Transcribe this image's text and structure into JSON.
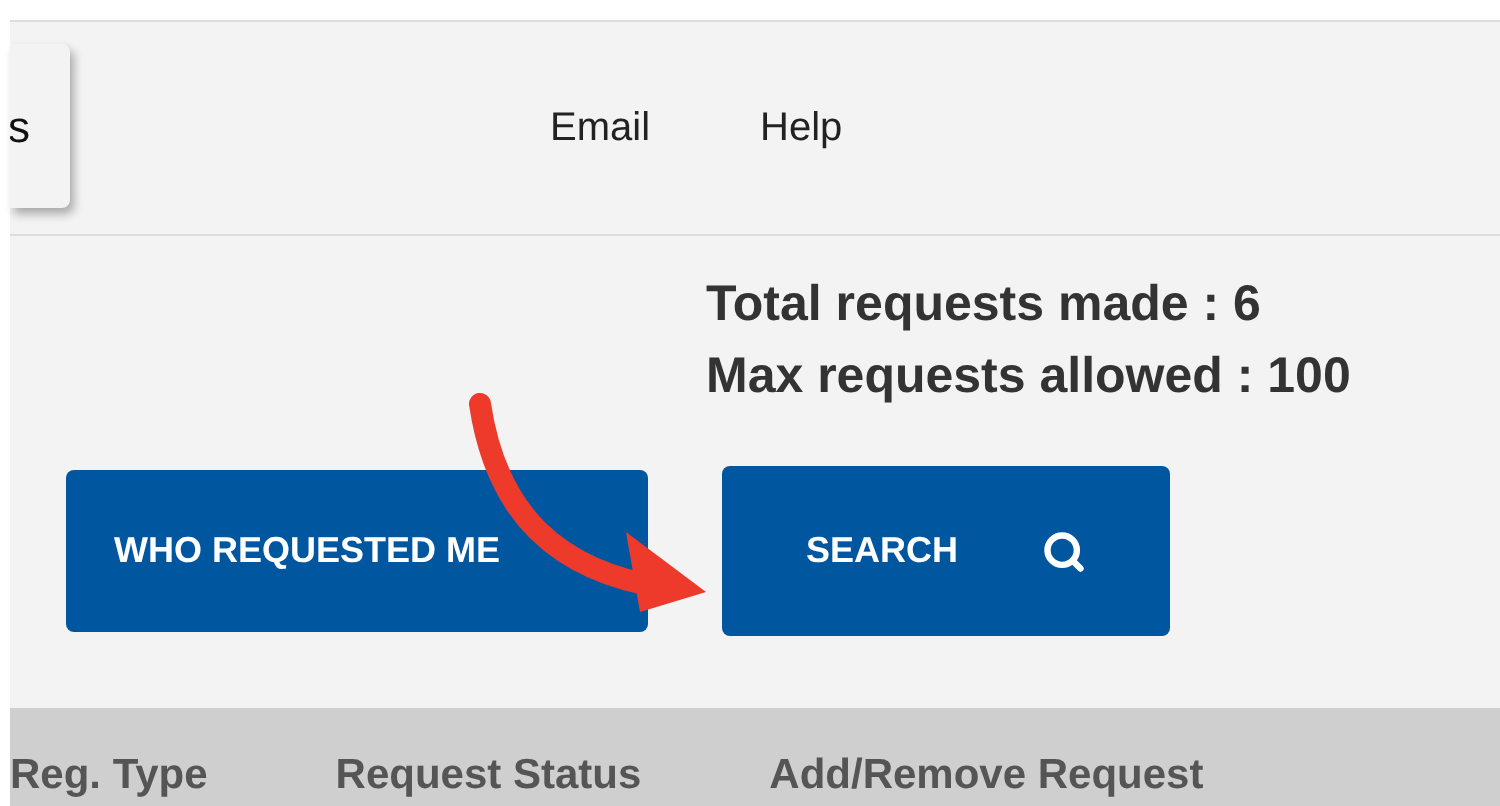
{
  "header": {
    "card_text": "s",
    "nav_links": [
      "Email",
      "Help"
    ]
  },
  "stats": [
    "Total requests made : 6",
    "Max requests allowed : 100"
  ],
  "buttons": [
    {
      "label": "WHO REQUESTED ME",
      "kind": "plain"
    },
    {
      "label": "SEARCH",
      "kind": "search"
    }
  ],
  "table": {
    "columns": [
      "Reg. Type",
      "Request Status",
      "Add/Remove Request"
    ]
  }
}
